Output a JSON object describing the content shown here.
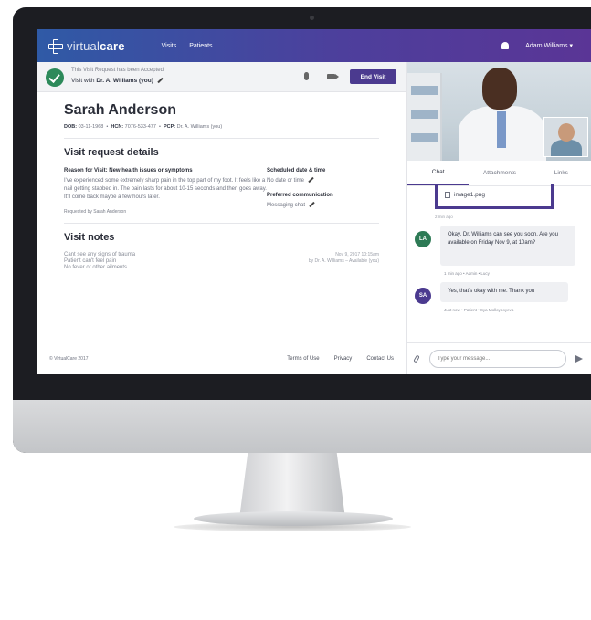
{
  "header": {
    "brand_light": "virtual",
    "brand_bold": "care",
    "nav": [
      "Visits",
      "Patients"
    ],
    "user": "Adam Williams ▾"
  },
  "visit_bar": {
    "status": "This Visit Request has been Accepted",
    "with_prefix": "Visit with ",
    "with_name": "Dr. A. Williams (you)",
    "end_visit": "End Visit"
  },
  "patient": {
    "name": "Sarah Anderson",
    "dob_label": "DOB:",
    "dob": "03-11-1968",
    "hcn_label": "HCN:",
    "hcn": "7076-533-477",
    "pcp_label": "PCP:",
    "pcp": "Dr. A. Williams (you)"
  },
  "request": {
    "title": "Visit request details",
    "reason_label": "Reason for Visit: New health issues or symptoms",
    "reason_text": "I've experienced some extremely sharp pain in the top part of my foot. It feels like a nail getting stabbed in. The pain lasts for about 10-15 seconds and then goes away. It'll come back maybe a few hours later.",
    "requested_by": "Requested by Sarah Anderson",
    "scheduled_label": "Scheduled date & time",
    "scheduled_value": "No date or time",
    "comm_label": "Preferred communication",
    "comm_value": "Messaging chat"
  },
  "notes": {
    "title": "Visit notes",
    "lines": [
      "Cant see any signs of trauma",
      "Patient can't feel pain",
      "No fever or other ailments"
    ],
    "meta_line1": "Nov 9, 2017 10:15am",
    "meta_line2": "by Dr. A. Williams – Available (you)"
  },
  "footer": {
    "copyright": "© VirtualCare 2017",
    "links": [
      "Terms of Use",
      "Privacy",
      "Contact Us"
    ]
  },
  "chat": {
    "tabs": [
      "Chat",
      "Attachments",
      "Links"
    ],
    "attachment_name": "image1.png",
    "attachment_time": "2 min ago",
    "messages": [
      {
        "initials": "LA",
        "text": "Okay, Dr. Williams can see you soon. Are you available on Friday Nov 9, at 10am?",
        "meta": "1 min ago • Admin • Lucy"
      },
      {
        "initials": "SA",
        "text": "Yes, that's okay with me. Thank you",
        "meta": "Just now • Patient • Sya Molloypoyeva"
      }
    ],
    "input_placeholder": "Type your message..."
  },
  "colors": {
    "header_start": "#2f5aa6",
    "header_end": "#5a3596",
    "accent": "#4b3a8f",
    "success": "#2d8a5a"
  }
}
